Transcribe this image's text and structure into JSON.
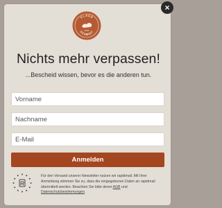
{
  "close": {
    "label": "×"
  },
  "logo": {
    "text_top": "CLAUS",
    "text_bottom": "SCHMIDT",
    "text_inner": "2026"
  },
  "heading": "Nichts mehr verpassen!",
  "subheading": "...Bescheid wissen, bevor es die anderen tun.",
  "form": {
    "first_name_placeholder": "Vorname",
    "last_name_placeholder": "Nachname",
    "email_placeholder": "E-Mail",
    "submit_label": "Anmelden"
  },
  "legal": {
    "text_before_agb": "Für den Versand unserer Newsletter nutzen wir rapidmail. Mit Ihrer Anmeldung stimmen Sie zu, dass die eingegebenen Daten an rapidmail übermittelt werden. Beachten Sie bitte deren ",
    "agb_link": "AGB",
    "text_between": " und ",
    "privacy_link": "Datenschutzbestimmungen",
    "text_after": "."
  },
  "colors": {
    "accent": "#a4461f",
    "modal_bg": "#e3ded6",
    "overlay": "#a8a098",
    "close_bg": "#2a2a2a"
  },
  "icons": {
    "close": "close-icon",
    "logo": "brand-logo",
    "badge": "rapidmail-badge-icon"
  }
}
